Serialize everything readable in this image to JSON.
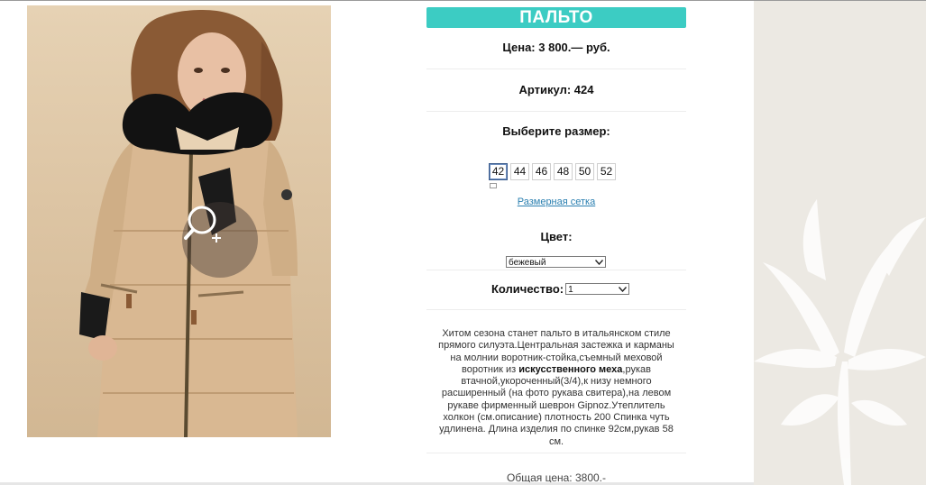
{
  "product": {
    "title": "ПАЛЬТО",
    "price": "Цена: 3 800.— руб.",
    "article": "Артикул: 424",
    "size_prompt": "Выберите размер:",
    "sizes": [
      "42",
      "44",
      "46",
      "48",
      "50",
      "52"
    ],
    "selected_size": "42",
    "size_chart_link": "Размерная сетка",
    "color_label": "Цвет:",
    "color_value": "бежевый",
    "quantity_label": "Количество:",
    "quantity_value": "1",
    "description_before_bold": "Хитом сезона станет пальто в итальянском стиле прямого силуэта.Центральная застежка и карманы на молнии воротник-стойка,съемный меховой воротник из ",
    "description_bold": "искусственного меха",
    "description_after_bold": ",рукав втачной,укороченный(3/4),к низу немного расширенный (на фото рукава свитера),на левом рукаве фирменный шеврон Gipnoz.Утеплитель холкон (см.описание) плотность 200 Спинка чуть удлинена. Длина изделия по спинке 92см,рукав 58 см.",
    "total": "Общая цена: 3800.-"
  },
  "colors": {
    "title_bar": "#3cccc3",
    "link": "#2a7fb0",
    "side_panel": "#ece9e3",
    "selected_size_border": "#3a5b8c"
  },
  "icons": {
    "zoom": "magnifier-plus-icon",
    "dropdown": "chevron-down-icon"
  }
}
